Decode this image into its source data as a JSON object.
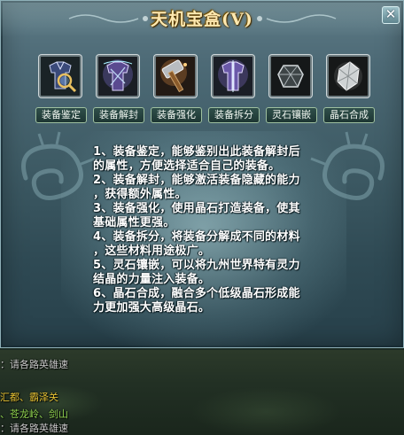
{
  "window": {
    "title": "天机宝盒(V)",
    "close_label": "✕"
  },
  "tools": [
    {
      "label": "装备鉴定",
      "icon": "identify-armor-icon"
    },
    {
      "label": "装备解封",
      "icon": "unseal-armor-icon"
    },
    {
      "label": "装备强化",
      "icon": "hammer-icon"
    },
    {
      "label": "装备拆分",
      "icon": "split-armor-icon"
    },
    {
      "label": "灵石镶嵌",
      "icon": "spirit-stone-icon"
    },
    {
      "label": "晶石合成",
      "icon": "crystal-icon"
    }
  ],
  "description": [
    "1、装备鉴定，能够鉴别出此装备解封后",
    "的属性，方便选择适合自己的装备。",
    "2、装备解封，能够激活装备隐藏的能力",
    "，获得额外属性。",
    "3、装备强化，使用晶石打造装备，使其",
    "基础属性更强。",
    "4、装备拆分，将装备分解成不同的材料",
    "，这些材料用途极广。",
    "5、灵石镶嵌，可以将九州世界特有灵力",
    "结晶的力量注入装备。",
    "6、晶石合成，融合多个低级晶石形成能",
    "力更加强大高级晶石。"
  ],
  "background_chat": [
    "：请各路英雄速",
    "汇都、霸泽关",
    "、苍龙岭、剑山",
    "：请各路英雄速"
  ],
  "colors": {
    "title": "#ffe9b0",
    "chat_yellow": "#e6c233",
    "chat_green": "#8fd14f"
  }
}
